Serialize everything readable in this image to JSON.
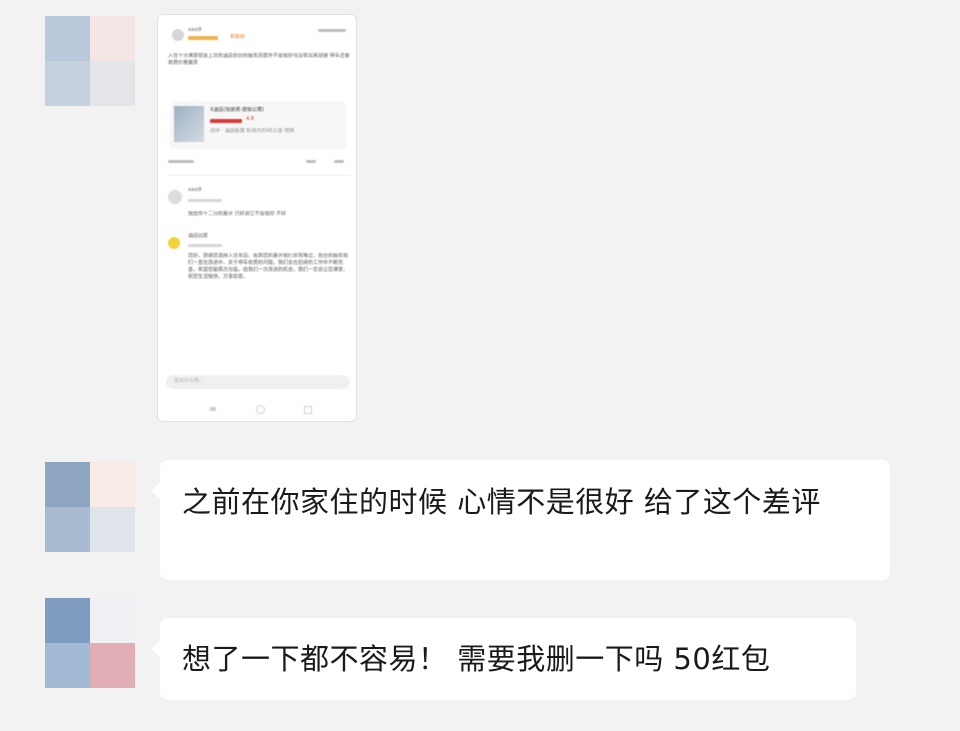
{
  "chat": {
    "messages": [
      {
        "type": "image",
        "screenshot": {
          "header_name": "xxx评",
          "header_tag": "有帮助",
          "body_text": "入住十分满意但是上次的酒店前台的服务态度并不是很好也没有出来迎接 停车还要收费价格偏贵",
          "hotel_name": "X酒店(观景房·度假公寓)",
          "hotel_rating": "4.8",
          "hotel_sub": "点评 · 酒店距离 机场大约45公里 地铁",
          "reply1_name": "xxx评",
          "reply1_text": "我给你十二分的差评 只好说它不是很好 不好",
          "reply2_name": "酒店回复",
          "reply2_text": "您好，感谢您选择入住本店。看到您的差评我们非常难过，前台的服务我们一直在改进中，关于停车收费的问题，我们会在后续的工作中不断完善，希望您能再次光临，给我们一次改进的机会，我们一定会让您满意，祝您生活愉快，万事如意。",
          "input_placeholder": "说点什么吧..."
        }
      },
      {
        "type": "text",
        "text": "之前在你家住的时候  心情不是很好  给了这个差评"
      },
      {
        "type": "text",
        "text": "想了一下都不容易！  需要我删一下吗  50红包"
      }
    ]
  },
  "colors": {
    "background": "#f2f2f2",
    "bubble": "#ffffff",
    "text": "#1a1a1a"
  }
}
